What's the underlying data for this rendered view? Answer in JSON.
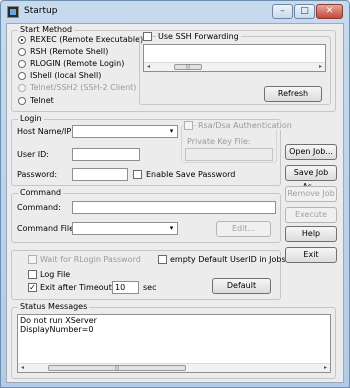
{
  "window": {
    "title": "Startup",
    "min": "–",
    "max": "□",
    "close": "✕"
  },
  "start_method": {
    "label": "Start Method",
    "options": [
      {
        "label": "REXEC (Remote Executable)",
        "selected": true,
        "enabled": true
      },
      {
        "label": "RSH (Remote Shell)",
        "selected": false,
        "enabled": true
      },
      {
        "label": "RLOGIN (Remote Login)",
        "selected": false,
        "enabled": true
      },
      {
        "label": "IShell (local Shell)",
        "selected": false,
        "enabled": true
      },
      {
        "label": "Telnet/SSH2 (SSH-2 Client)",
        "selected": false,
        "enabled": false
      },
      {
        "label": "Telnet",
        "selected": false,
        "enabled": true
      }
    ],
    "ssh_forwarding_label": "Use SSH Forwarding",
    "ssh_forwarding_checked": false,
    "refresh_label": "Refresh"
  },
  "login": {
    "label": "Login",
    "host_label": "Host Name/IP:",
    "host_value": "",
    "user_label": "User ID:",
    "user_value": "",
    "password_label": "Password:",
    "password_value": "",
    "save_password_label": "Enable Save Password",
    "rsa_label": "Rsa/Dsa Authentication",
    "private_key_label": "Private Key File:",
    "private_key_value": ""
  },
  "command": {
    "label": "Command",
    "command_label": "Command:",
    "command_value": "",
    "command_file_label": "Command File:",
    "command_file_value": "",
    "edit_label": "Edit..."
  },
  "options": {
    "wait_rlogin_label": "Wait for RLogin Password",
    "empty_userid_label": "empty Default UserID in Jobs",
    "log_file_label": "Log File",
    "exit_timeout_label": "Exit after Timeout of",
    "exit_timeout_checked": true,
    "timeout_value": "10",
    "timeout_unit": "sec",
    "default_label": "Default"
  },
  "status": {
    "label": "Status Messages",
    "lines": [
      "Do not run XServer",
      "DisplayNumber=0"
    ]
  },
  "side_buttons": {
    "open_job": "Open Job...",
    "save_job_as": "Save Job As...",
    "remove_job": "Remove Job",
    "execute": "Execute",
    "help": "Help",
    "exit": "Exit"
  },
  "scroll": {
    "left": "◂",
    "right": "▸",
    "grip": "|||"
  },
  "combo_arrow": "▾",
  "check_mark": "✓"
}
